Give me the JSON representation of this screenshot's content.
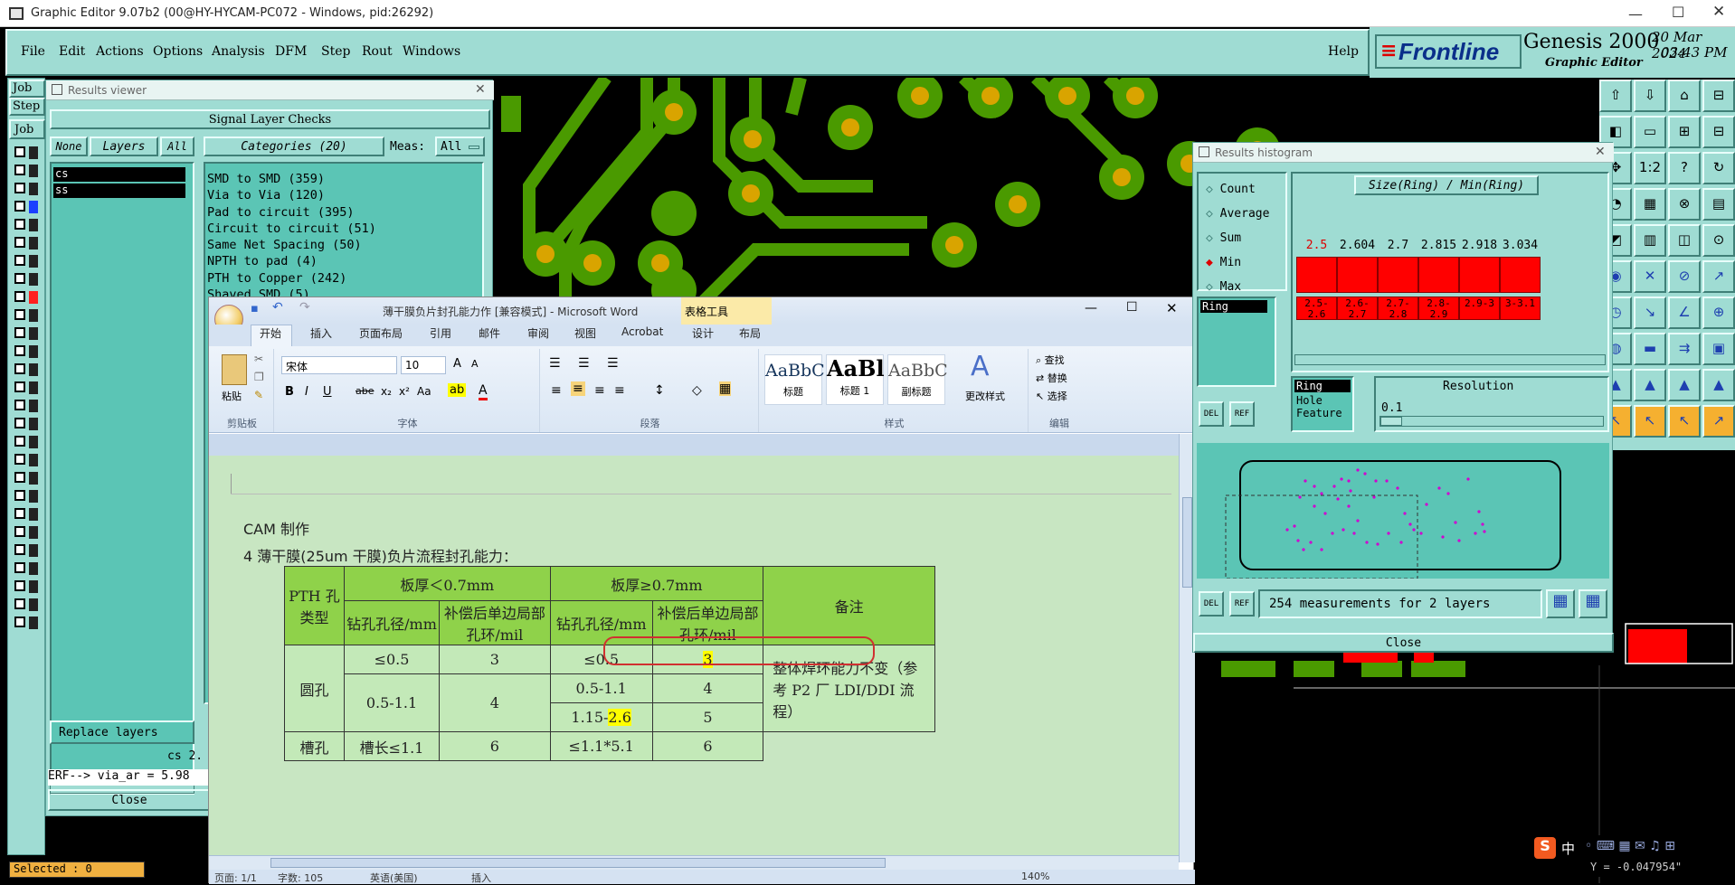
{
  "window": {
    "title": "Graphic Editor 9.07b2 (00@HY-HYCAM-PC072 - Windows, pid:26292)"
  },
  "menu": [
    "File",
    "Edit",
    "Actions",
    "Options",
    "Analysis",
    "DFM",
    "Step",
    "Rout",
    "Windows"
  ],
  "help": "Help",
  "brand": {
    "logo": "Frontline",
    "product": "Genesis 2000",
    "sub": "Graphic Editor",
    "date": "20 Mar 2024",
    "time": "03:43 PM"
  },
  "left_labels": [
    "Job",
    "Step",
    "Job"
  ],
  "results_viewer": {
    "title": "Results viewer",
    "header": "Signal Layer Checks",
    "btn_none": "None",
    "btn_layers": "Layers",
    "btn_all": "All",
    "categories": "Categories (20)",
    "meas_label": "Meas:",
    "meas_value": "All",
    "layers": [
      "cs",
      "ss"
    ],
    "checks": [
      "SMD to SMD (359)",
      "Via to Via (120)",
      "Pad to circuit (395)",
      "Circuit to circuit (51)",
      "Same Net Spacing (50)",
      "NPTH to pad (4)",
      "PTH to Copper (242)",
      "Shaved SMD (5)"
    ],
    "replace": "Replace layers",
    "cs2": "cs 2.",
    "erf": "ERF--> via_ar = 5.98",
    "close": "Close"
  },
  "selected": "Selected : 0",
  "word": {
    "title": "薄干膜负片封孔能力作 [兼容模式] - Microsoft Word",
    "tools": "表格工具",
    "tabs": [
      "开始",
      "插入",
      "页面布局",
      "引用",
      "邮件",
      "审阅",
      "视图",
      "Acrobat",
      "设计",
      "布局"
    ],
    "font": "宋体",
    "size": "10",
    "groups": [
      "剪贴板",
      "字体",
      "段落",
      "样式",
      "编辑"
    ],
    "paste": "粘贴",
    "styles": [
      {
        "sample": "AaBbC",
        "name": "标题"
      },
      {
        "sample": "AaBl",
        "name": "标题 1"
      },
      {
        "sample": "AaBbC",
        "name": "副标题"
      }
    ],
    "change_style": "更改样式",
    "edit": [
      "查找",
      "替换",
      "选择"
    ],
    "heading": "CAM 制作",
    "subheading": "4 薄干膜(25um 干膜)负片流程封孔能力：",
    "table": {
      "h_type": "PTH 孔类型",
      "h_lt": "板厚＜0.7mm",
      "h_ge": "板厚≥0.7mm",
      "h_note": "备注",
      "h_drill": "钻孔孔径/mm",
      "h_ring": "补偿后单边局部孔环/mil",
      "round": "圆孔",
      "slot": "槽孔",
      "r1": [
        "≤0.5",
        "3",
        "≤0.5",
        "3"
      ],
      "r2a": [
        "0.5-1.1",
        "4",
        "0.5-1.1",
        "4"
      ],
      "r2b": [
        "1.15-",
        "2.6",
        "5"
      ],
      "r3": [
        "槽长≤1.1",
        "6",
        "≤1.1*5.1",
        "6"
      ],
      "note": "整体焊环能力不变（参考 P2 厂 LDI/DDI 流程）"
    },
    "status": {
      "page": "页面: 1/1",
      "words": "字数: 105",
      "lang": "英语(美国)",
      "mode": "插入",
      "zoom": "140%"
    }
  },
  "histogram": {
    "title": "Results histogram",
    "options": [
      "Count",
      "Average",
      "Sum",
      "Min",
      "Max"
    ],
    "selected": "Min",
    "chart_title": "Size(Ring) / Min(Ring)",
    "values": [
      "2.5",
      "2.604",
      "2.7",
      "2.815",
      "2.918",
      "3.034"
    ],
    "ranges": [
      "2.5-2.6",
      "2.6-2.7",
      "2.7-2.8",
      "2.8-2.9",
      "2.9-3",
      "3-3.1"
    ],
    "ring": "Ring",
    "list": [
      "Ring",
      "Hole",
      "Feature"
    ],
    "resolution": "Resolution",
    "res_value": "0.1",
    "del": "DEL",
    "ref": "REF",
    "measurements": "254 measurements for 2 layers",
    "close": "Close"
  },
  "coord": "Y = -0.047954\"",
  "ime": "中"
}
